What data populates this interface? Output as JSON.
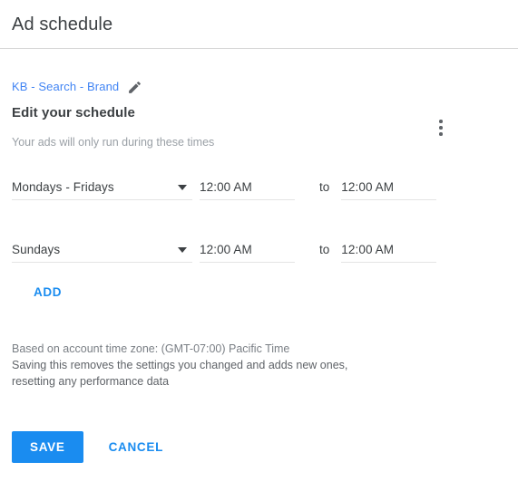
{
  "header": {
    "title": "Ad schedule"
  },
  "panel": {
    "campaign_name": "KB - Search - Brand",
    "edit_icon": "pencil-icon",
    "overflow_icon": "kebab-menu-icon",
    "section_heading": "Edit your schedule",
    "section_subtitle": "Your ads will only run during these times",
    "to_label": "to",
    "add_label": "ADD",
    "rows": [
      {
        "day": "Mondays - Fridays",
        "caret_icon": "chevron-down-icon",
        "start_time": "12:00 AM",
        "end_time": "12:00 AM"
      },
      {
        "day": "Sundays",
        "caret_icon": "chevron-down-icon",
        "start_time": "12:00 AM",
        "end_time": "12:00 AM"
      }
    ]
  },
  "notes": {
    "timezone": "Based on account time zone: (GMT-07:00) Pacific Time",
    "warning": "Saving this removes the settings you changed and adds new ones, resetting any performance data"
  },
  "actions": {
    "save_label": "SAVE",
    "cancel_label": "CANCEL"
  },
  "colors": {
    "accent_blue": "#1a8cf0",
    "link_blue": "#4285f4",
    "text_primary": "#3c4043",
    "text_muted": "#9aa0a6"
  }
}
